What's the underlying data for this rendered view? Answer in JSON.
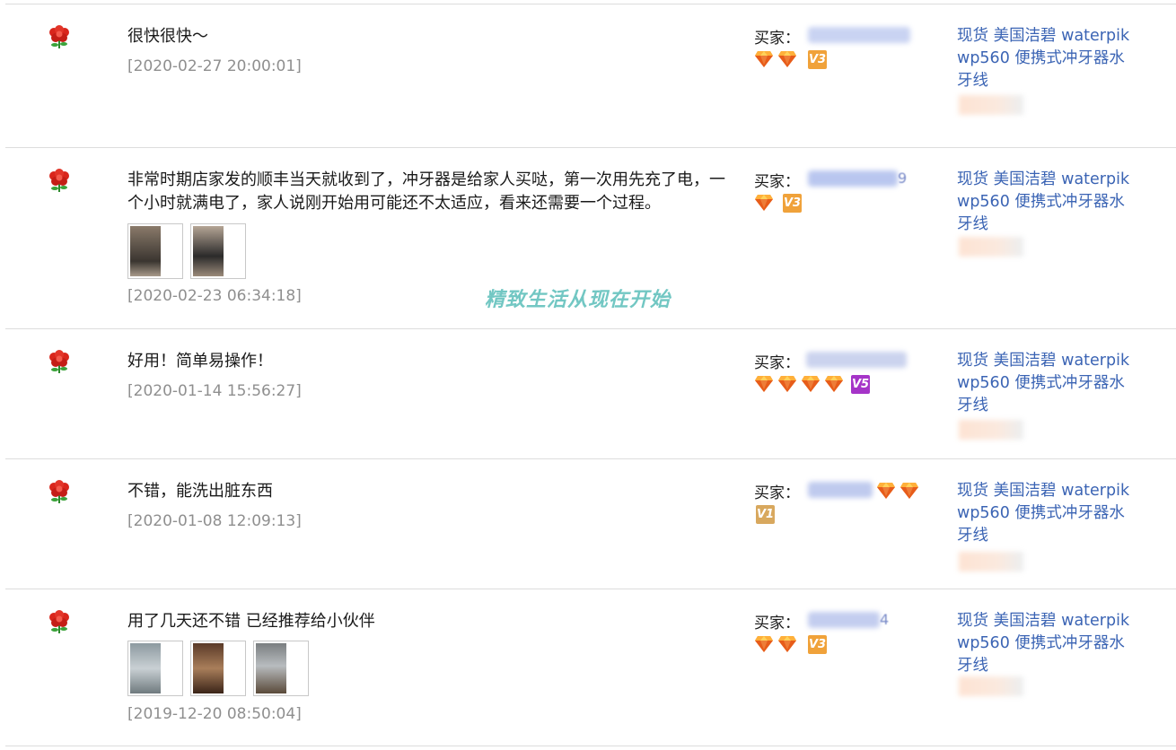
{
  "buyer_label": "买家：",
  "watermark": "精致生活从现在开始",
  "product_name": "现货 美国洁碧 waterpik wp560 便携式冲牙器水牙线",
  "colors": {
    "link": "#3b64b4",
    "date": "#8f8f8f",
    "rule": "#dddddd",
    "watermark": "#72c7c3"
  },
  "reviews": [
    {
      "comment": "很快很快～",
      "date": "[2020-02-27 20:00:01]",
      "buyer_tail": "",
      "diamonds": 2,
      "vip_level": "V3",
      "photos": 0
    },
    {
      "comment": "非常时期店家发的顺丰当天就收到了，冲牙器是给家人买哒，第一次用先充了电，一个小时就满电了，家人说刚开始用可能还不太适应，看来还需要一个过程。",
      "date": "[2020-02-23 06:34:18]",
      "buyer_tail": "9",
      "diamonds": 1,
      "vip_level": "V3",
      "photos": 2
    },
    {
      "comment": "好用！简单易操作！",
      "date": "[2020-01-14 15:56:27]",
      "buyer_tail": "",
      "diamonds": 4,
      "vip_level": "V5",
      "photos": 0
    },
    {
      "comment": "不错，能洗出脏东西",
      "date": "[2020-01-08 12:09:13]",
      "buyer_tail": "",
      "diamonds": 2,
      "vip_level": "V1",
      "photos": 0
    },
    {
      "comment": "用了几天还不错 已经推荐给小伙伴",
      "date": "[2019-12-20 08:50:04]",
      "buyer_tail": "4",
      "diamonds": 2,
      "vip_level": "V3",
      "photos": 3
    }
  ]
}
